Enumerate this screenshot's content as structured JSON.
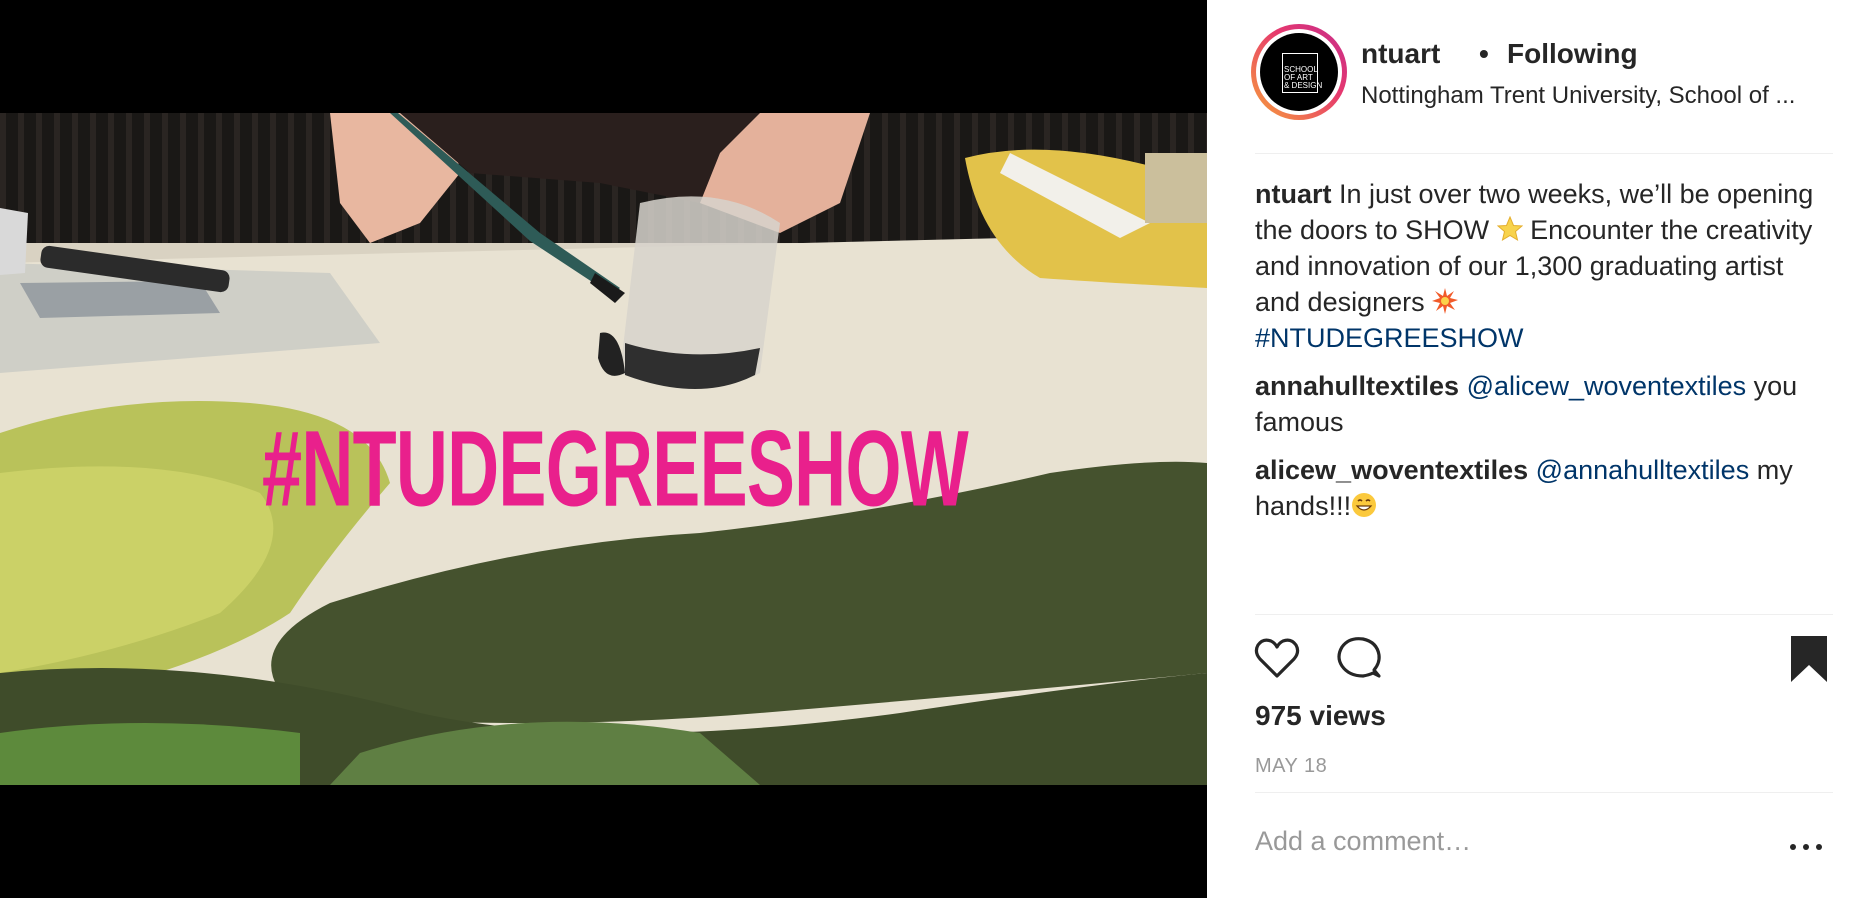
{
  "post": {
    "overlay_hashtag": "#NTUDEGREESHOW"
  },
  "header": {
    "username": "ntuart",
    "separator": "•",
    "follow_status": "Following",
    "location": "Nottingham Trent University, School of ...",
    "avatar_logo_lines": [
      "SCHOOL",
      "OF ART",
      "& DESIGN"
    ]
  },
  "caption": {
    "username": "ntuart",
    "text_part1": "In just over two weeks, we’ll be opening the doors to SHOW",
    "text_part2": " Encounter the creativity and innovation of our 1,300 graduating artist and designers",
    "hashtag": "#NTUDEGREESHOW"
  },
  "comments": [
    {
      "username": "annahulltextiles",
      "mention": "@alicew_woventextiles",
      "text": " you famous"
    },
    {
      "username": "alicew_woventextiles",
      "mention": "@annahulltextiles",
      "text": " my hands!!!"
    }
  ],
  "actions": {
    "like_icon": "heart-outline-icon",
    "comment_icon": "comment-bubble-icon",
    "save_icon": "bookmark-filled-icon"
  },
  "views": "975 views",
  "date": "MAY 18",
  "add_comment": {
    "placeholder": "Add a comment…"
  },
  "colors": {
    "link": "#003569",
    "hashtag_overlay": "#e9208c",
    "muted": "#999999"
  }
}
